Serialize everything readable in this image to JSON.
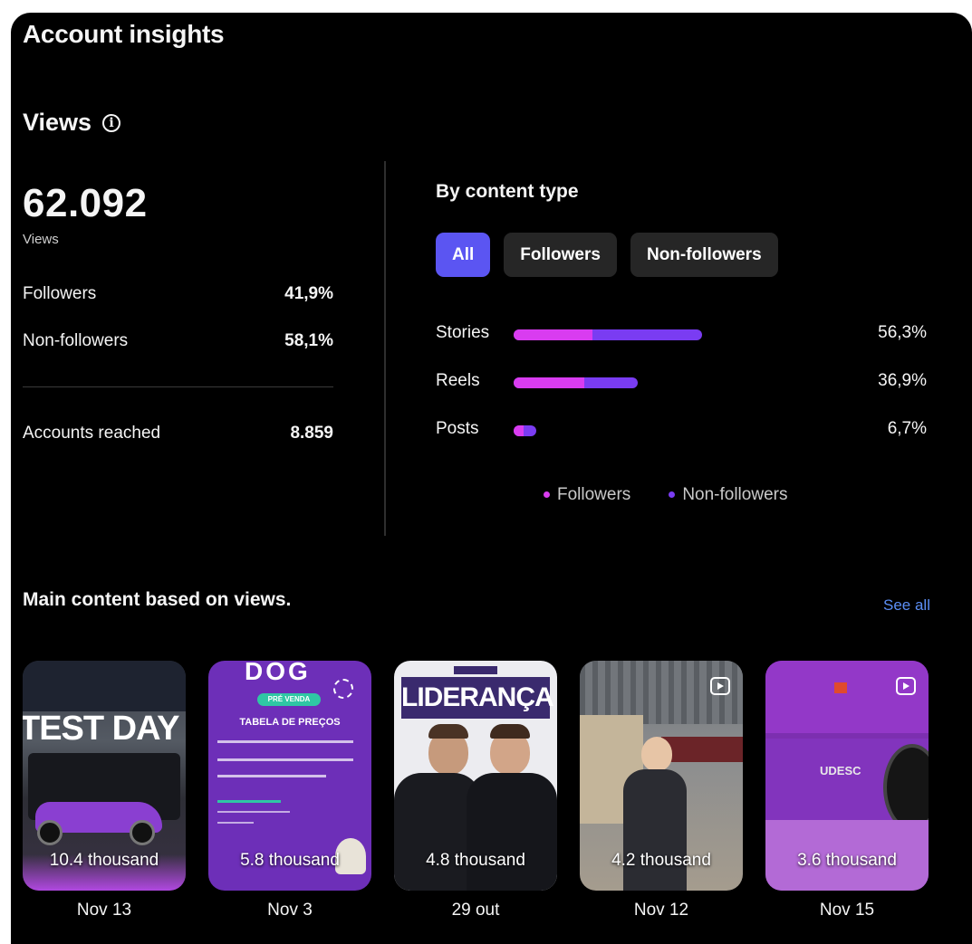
{
  "title": "Account insights",
  "views": {
    "heading": "Views",
    "total": "62.092",
    "total_label": "Views",
    "rows": [
      {
        "label": "Followers",
        "value": "41,9%"
      },
      {
        "label": "Non-followers",
        "value": "58,1%"
      }
    ],
    "reached_label": "Accounts reached",
    "reached_value": "8.859"
  },
  "content_type": {
    "heading": "By content type",
    "tabs": [
      {
        "label": "All",
        "active": true
      },
      {
        "label": "Followers",
        "active": false
      },
      {
        "label": "Non-followers",
        "active": false
      }
    ],
    "bars": [
      {
        "label": "Stories",
        "pct": "56,3%",
        "total_fraction": 0.563,
        "followers_fraction": 0.235
      },
      {
        "label": "Reels",
        "pct": "36,9%",
        "total_fraction": 0.369,
        "followers_fraction": 0.21
      },
      {
        "label": "Posts",
        "pct": "6,7%",
        "total_fraction": 0.067,
        "followers_fraction": 0.03
      }
    ],
    "legend": [
      {
        "label": "Followers",
        "color": "#d93cf0"
      },
      {
        "label": "Non-followers",
        "color": "#7a3cf2"
      }
    ]
  },
  "main_content": {
    "heading": "Main content based on views.",
    "see_all": "See all",
    "items": [
      {
        "count": "10.4 thousand",
        "date": "Nov 13"
      },
      {
        "count": "5.8 thousand",
        "date": "Nov 3"
      },
      {
        "count": "4.8 thousand",
        "date": "29 out"
      },
      {
        "count": "4.2 thousand",
        "date": "Nov 12"
      },
      {
        "count": "3.6 thousand",
        "date": "Nov 15"
      }
    ],
    "thumb_text": {
      "t1_banner": "TEST DAY",
      "t2_logo": "DOG",
      "t2_badge": "PRÉ VENDA",
      "t2_heading": "TABELA DE PREÇOS",
      "t3_banner": "LIDERANÇA",
      "t5_logo": "UDESC"
    }
  },
  "colors": {
    "accent": "#5b55f2",
    "followers": "#d93cf0",
    "non_followers": "#7a3cf2",
    "link": "#5b8ef5"
  }
}
